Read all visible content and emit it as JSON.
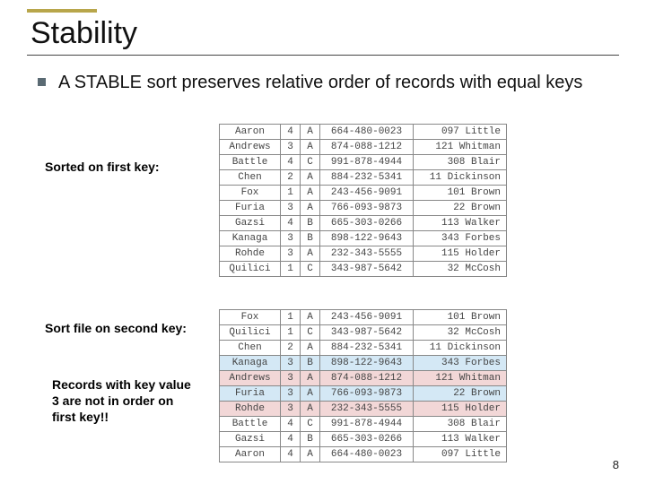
{
  "title": "Stability",
  "bullet": "A STABLE sort  preserves relative order of records with equal keys",
  "labels": {
    "sorted_first": "Sorted on first key:",
    "sort_second": "Sort file on second key:",
    "note": "Records with key value 3 are not in order on first key!!"
  },
  "page_num": "8",
  "table1": [
    {
      "name": "Aaron",
      "k1": "4",
      "k2": "A",
      "num": "664-480-0023",
      "addr": "097 Little"
    },
    {
      "name": "Andrews",
      "k1": "3",
      "k2": "A",
      "num": "874-088-1212",
      "addr": "121 Whitman"
    },
    {
      "name": "Battle",
      "k1": "4",
      "k2": "C",
      "num": "991-878-4944",
      "addr": "308 Blair"
    },
    {
      "name": "Chen",
      "k1": "2",
      "k2": "A",
      "num": "884-232-5341",
      "addr": "11 Dickinson"
    },
    {
      "name": "Fox",
      "k1": "1",
      "k2": "A",
      "num": "243-456-9091",
      "addr": "101 Brown"
    },
    {
      "name": "Furia",
      "k1": "3",
      "k2": "A",
      "num": "766-093-9873",
      "addr": "22 Brown"
    },
    {
      "name": "Gazsi",
      "k1": "4",
      "k2": "B",
      "num": "665-303-0266",
      "addr": "113 Walker"
    },
    {
      "name": "Kanaga",
      "k1": "3",
      "k2": "B",
      "num": "898-122-9643",
      "addr": "343 Forbes"
    },
    {
      "name": "Rohde",
      "k1": "3",
      "k2": "A",
      "num": "232-343-5555",
      "addr": "115 Holder"
    },
    {
      "name": "Quilici",
      "k1": "1",
      "k2": "C",
      "num": "343-987-5642",
      "addr": "32 McCosh"
    }
  ],
  "table2": [
    {
      "name": "Fox",
      "k1": "1",
      "k2": "A",
      "num": "243-456-9091",
      "addr": "101 Brown",
      "hl": ""
    },
    {
      "name": "Quilici",
      "k1": "1",
      "k2": "C",
      "num": "343-987-5642",
      "addr": "32 McCosh",
      "hl": ""
    },
    {
      "name": "Chen",
      "k1": "2",
      "k2": "A",
      "num": "884-232-5341",
      "addr": "11 Dickinson",
      "hl": "",
      "sep": true
    },
    {
      "name": "Kanaga",
      "k1": "3",
      "k2": "B",
      "num": "898-122-9643",
      "addr": "343 Forbes",
      "hl": "blue",
      "sep": true
    },
    {
      "name": "Andrews",
      "k1": "3",
      "k2": "A",
      "num": "874-088-1212",
      "addr": "121 Whitman",
      "hl": "pink"
    },
    {
      "name": "Furia",
      "k1": "3",
      "k2": "A",
      "num": "766-093-9873",
      "addr": "22 Brown",
      "hl": "blue"
    },
    {
      "name": "Rohde",
      "k1": "3",
      "k2": "A",
      "num": "232-343-5555",
      "addr": "115 Holder",
      "hl": "pink"
    },
    {
      "name": "Battle",
      "k1": "4",
      "k2": "C",
      "num": "991-878-4944",
      "addr": "308 Blair",
      "hl": "",
      "sep": true
    },
    {
      "name": "Gazsi",
      "k1": "4",
      "k2": "B",
      "num": "665-303-0266",
      "addr": "113 Walker",
      "hl": ""
    },
    {
      "name": "Aaron",
      "k1": "4",
      "k2": "A",
      "num": "664-480-0023",
      "addr": "097 Little",
      "hl": ""
    }
  ]
}
